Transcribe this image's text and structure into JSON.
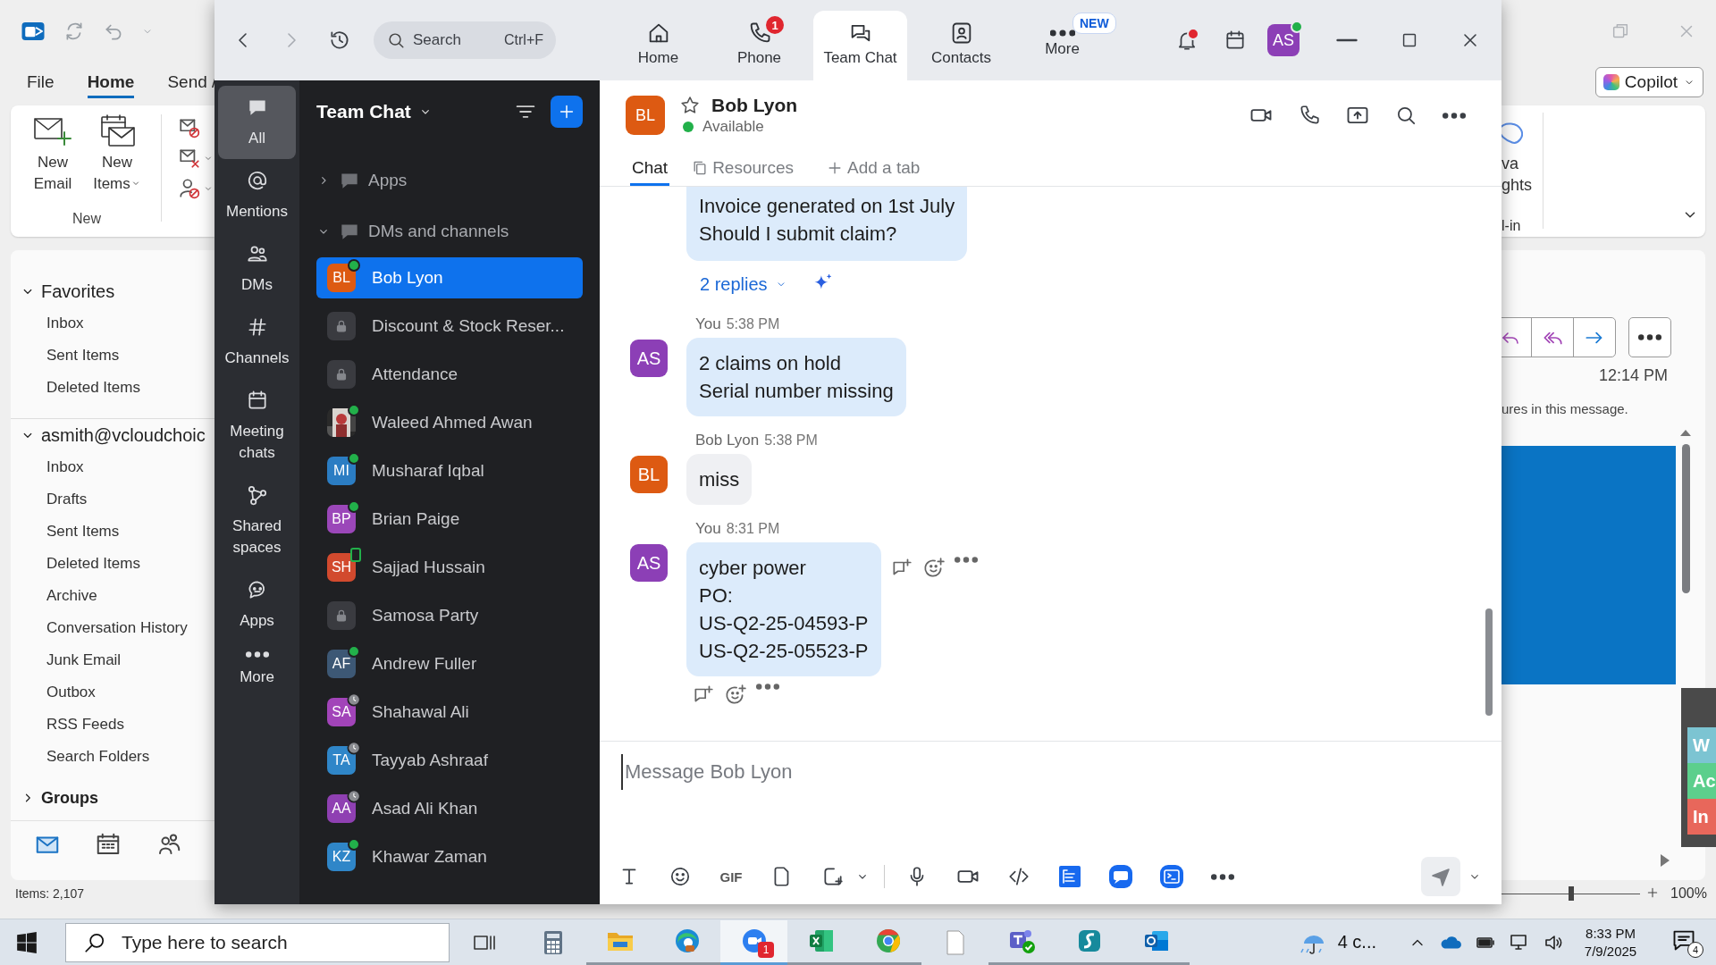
{
  "outlook": {
    "menu_tabs": [
      {
        "label": "File",
        "selected": false
      },
      {
        "label": "Home",
        "selected": true
      },
      {
        "label": "Send /",
        "selected": false
      }
    ],
    "ribbon": {
      "buttons": [
        {
          "label": "New Email",
          "kind": "email"
        },
        {
          "label": "New Items",
          "kind": "items"
        }
      ],
      "group": "New",
      "cut_label": [
        "va",
        "ghts"
      ],
      "cut_group": "l-in"
    },
    "copilot": "Copilot",
    "folders": [
      {
        "label": "Favorites",
        "expanded": true,
        "children": [
          {
            "label": "Inbox"
          },
          {
            "label": "Sent Items"
          },
          {
            "label": "Deleted Items"
          }
        ]
      },
      {
        "label": "asmith@vcloudchoic",
        "expanded": true,
        "children": [
          {
            "label": "Inbox"
          },
          {
            "label": "Drafts"
          },
          {
            "label": "Sent Items"
          },
          {
            "label": "Deleted Items"
          },
          {
            "label": "Archive"
          },
          {
            "label": "Conversation History"
          },
          {
            "label": "Junk Email"
          },
          {
            "label": "Outbox"
          },
          {
            "label": "RSS Feeds"
          },
          {
            "label": "Search Folders"
          }
        ]
      },
      {
        "label": "Groups",
        "expanded": false
      }
    ],
    "status": "Items: 2,107",
    "reading": {
      "time": "12:14 PM",
      "notice": "ures in this message.",
      "side_tabs": [
        {
          "label": "W",
          "color": "#7cc4d2"
        },
        {
          "label": "Ac",
          "color": "#5ccf8c"
        },
        {
          "label": "In",
          "color": "#e8675b"
        }
      ],
      "zoom_slider": {
        "level": 0.5
      },
      "zoom_level": "100%"
    }
  },
  "zoom": {
    "search": {
      "placeholder": "Search",
      "shortcut": "Ctrl+F"
    },
    "nav": [
      {
        "label": "Home",
        "kind": "home",
        "selected": false
      },
      {
        "label": "Phone",
        "kind": "phone",
        "badge": "1",
        "selected": false
      },
      {
        "label": "Team Chat",
        "kind": "chat",
        "selected": true
      },
      {
        "label": "Contacts",
        "kind": "contacts",
        "selected": false
      },
      {
        "label": "More",
        "kind": "more",
        "badge": "NEW",
        "selected": false
      }
    ],
    "notifications_unread": true,
    "user": {
      "initials": "AS",
      "color": "#8c3fb6",
      "presence": {
        "kind": "available"
      }
    },
    "rail": [
      {
        "label": "All",
        "kind": "all",
        "selected": true
      },
      {
        "label": "Mentions",
        "kind": "mentions",
        "selected": false
      },
      {
        "label": "DMs",
        "kind": "dms",
        "selected": false
      },
      {
        "label": "Channels",
        "kind": "channels",
        "selected": false
      },
      {
        "label": "Meeting chats",
        "kind": "meetings",
        "selected": false
      },
      {
        "label": "Shared spaces",
        "kind": "spaces",
        "selected": false
      },
      {
        "label": "Apps",
        "kind": "apps",
        "selected": false
      },
      {
        "label": "More",
        "kind": "more",
        "selected": false
      }
    ],
    "list": {
      "title": "Team Chat",
      "sections": [
        {
          "label": "Apps",
          "expanded": false
        },
        {
          "label": "DMs and channels",
          "expanded": true,
          "children": [
            {
              "name": "Bob Lyon",
              "kind": "initials",
              "initials": "BL",
              "color": "#dd5a12",
              "presence": {
                "kind": "available"
              },
              "selected": true
            },
            {
              "name": "Discount & Stock Reser...",
              "kind": "lock",
              "selected": false
            },
            {
              "name": "Attendance",
              "kind": "lock",
              "selected": false
            },
            {
              "name": "Waleed Ahmed Awan",
              "kind": "picture",
              "presence": {
                "kind": "available"
              },
              "selected": false
            },
            {
              "name": "Musharaf Iqbal",
              "kind": "initials",
              "initials": "MI",
              "color": "#2b7dc3",
              "presence": {
                "kind": "available"
              },
              "selected": false
            },
            {
              "name": "Brian Paige",
              "kind": "initials",
              "initials": "BP",
              "color": "#9b47b9",
              "presence": {
                "kind": "available"
              },
              "selected": false
            },
            {
              "name": "Sajjad Hussain",
              "kind": "initials",
              "initials": "SH",
              "color": "#d24a2e",
              "presence": {
                "kind": "mobile"
              },
              "selected": false
            },
            {
              "name": "Samosa Party",
              "kind": "lock",
              "selected": false
            },
            {
              "name": "Andrew Fuller",
              "kind": "initials",
              "initials": "AF",
              "color": "#3d5875",
              "presence": {
                "kind": "available"
              },
              "selected": false
            },
            {
              "name": "Shahawal Ali",
              "kind": "initials",
              "initials": "SA",
              "color": "#a244b9",
              "presence": {
                "kind": "away"
              },
              "selected": false
            },
            {
              "name": "Tayyab Ashraaf",
              "kind": "initials",
              "initials": "TA",
              "color": "#2f86c8",
              "presence": {
                "kind": "away"
              },
              "selected": false
            },
            {
              "name": "Asad Ali Khan",
              "kind": "initials",
              "initials": "AA",
              "color": "#8f40b2",
              "presence": {
                "kind": "away"
              },
              "selected": false
            },
            {
              "name": "Khawar Zaman",
              "kind": "initials",
              "initials": "KZ",
              "color": "#2f86c8",
              "presence": {
                "kind": "available"
              },
              "selected": false
            }
          ]
        }
      ]
    },
    "chat": {
      "contact": {
        "initials": "BL",
        "color": "#dd5a12",
        "name": "Bob Lyon",
        "status": "Available",
        "starred": false
      },
      "tabs": [
        {
          "label": "Chat",
          "kind": "chat",
          "selected": true
        },
        {
          "label": "Resources",
          "kind": "resources",
          "selected": false
        },
        {
          "label": "Add a tab",
          "kind": "add",
          "selected": false
        }
      ],
      "messages": [
        {
          "kind": "continued",
          "mine": true,
          "lines": [
            "Invoice generated on 1st July",
            "Should I submit claim?"
          ],
          "replies": "2 replies"
        },
        {
          "kind": "message",
          "sender": "You",
          "time": "5:38 PM",
          "initials": "AS",
          "color": "#8c3fb6",
          "mine": true,
          "hovered": false,
          "lines": [
            "2 claims on hold",
            "Serial number missing"
          ]
        },
        {
          "kind": "message",
          "sender": "Bob Lyon",
          "time": "5:38 PM",
          "initials": "BL",
          "color": "#dd5a12",
          "mine": false,
          "hovered": false,
          "lines": [
            "miss"
          ]
        },
        {
          "kind": "message",
          "sender": "You",
          "time": "8:31 PM",
          "initials": "AS",
          "color": "#8c3fb6",
          "mine": true,
          "hovered": true,
          "lines": [
            "cyber power",
            "PO:",
            "US-Q2-25-04593-P",
            "US-Q2-25-05523-P"
          ]
        }
      ],
      "composer": {
        "placeholder": "Message Bob Lyon",
        "gif": "GIF"
      }
    }
  },
  "taskbar": {
    "search_placeholder": "Type here to search",
    "apps": [
      {
        "kind": "task_view",
        "running": false,
        "selected": false
      },
      {
        "kind": "calculator",
        "running": false,
        "selected": false
      },
      {
        "kind": "folder",
        "running": true,
        "selected": false
      },
      {
        "kind": "edge",
        "running": true,
        "selected": false
      },
      {
        "kind": "zoom",
        "running": true,
        "selected": true,
        "badge": "1"
      },
      {
        "kind": "excel",
        "running": true,
        "selected": false
      },
      {
        "kind": "chrome",
        "running": true,
        "selected": false
      },
      {
        "kind": "file",
        "running": false,
        "selected": false
      },
      {
        "kind": "teams",
        "running": true,
        "selected": false
      },
      {
        "kind": "vpn",
        "running": true,
        "selected": false
      },
      {
        "kind": "outlook",
        "running": true,
        "selected": false
      }
    ],
    "weather": "4 c...",
    "time": "8:33 PM",
    "date": "7/9/2025",
    "notifications": "4"
  }
}
